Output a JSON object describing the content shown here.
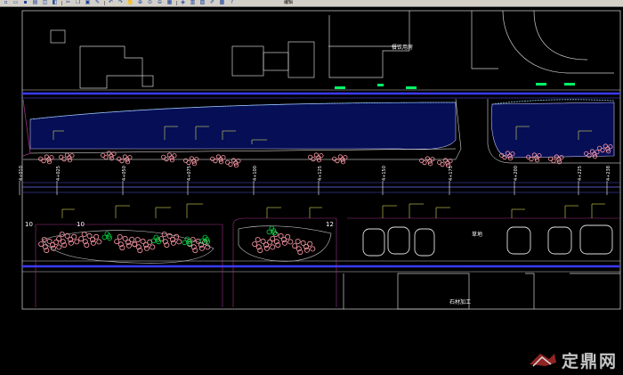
{
  "toolbar": {
    "buttons": [
      "new-icon",
      "open-icon",
      "save-icon",
      "print-icon",
      "preview-icon",
      "publish-icon",
      "cut-icon",
      "copy-icon",
      "paste-icon",
      "match-icon",
      "undo-icon",
      "redo-icon",
      "pan-icon",
      "zoom-realtime-icon",
      "zoom-window-icon",
      "zoom-previous-icon",
      "properties-icon",
      "designcenter-icon",
      "toolpalette-icon",
      "sheetset-icon",
      "markup-icon",
      "calc-icon",
      "help-icon"
    ],
    "edit_label": "编辑"
  },
  "colors": {
    "background": "#000000",
    "frame": "#ffffff",
    "road_edge": "#3333ff",
    "water": "#0a1a8a",
    "axis_line": "#6a6aff",
    "planting": "#ff9aa8",
    "shrub_green": "#00dd44",
    "dimension": "#ffff66",
    "magenta": "#a0308a"
  },
  "labels": {
    "top_building": "餐饮用房",
    "grass": "草地",
    "bottom_building": "石材加工",
    "left_number": "10",
    "left_number_2": "10",
    "mid_number": "12"
  },
  "station_marks": [
    "4+010",
    "4+025",
    "4+050",
    "4+075",
    "4+100",
    "4+125",
    "4+150",
    "4+175",
    "4+200",
    "4+225",
    "4+238"
  ],
  "watermark": {
    "text": "定鼎网"
  }
}
